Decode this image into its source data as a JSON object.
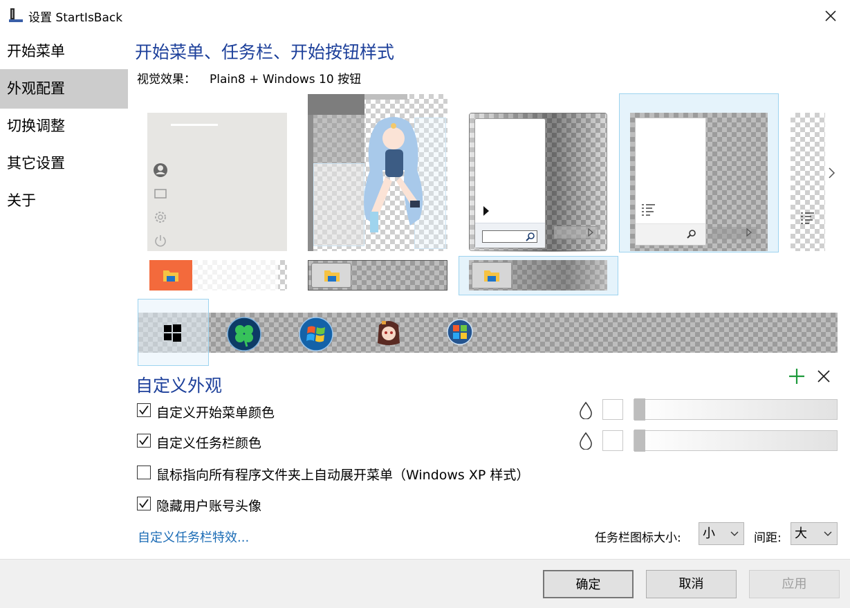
{
  "window": {
    "title": "设置 StartIsBack"
  },
  "sidebar": {
    "items": [
      {
        "label": "开始菜单"
      },
      {
        "label": "外观配置",
        "active": true
      },
      {
        "label": "切换调整"
      },
      {
        "label": "其它设置"
      },
      {
        "label": "关于"
      }
    ]
  },
  "main": {
    "style_title": "开始菜单、任务栏、开始按钮样式",
    "visual_label": "视觉效果：",
    "visual_value": "Plain8 + Windows 10 按钮",
    "custom_title": "自定义外观",
    "options": [
      {
        "label": "自定义开始菜单颜色",
        "checked": true
      },
      {
        "label": "自定义任务栏颜色",
        "checked": true
      },
      {
        "label": "鼠标指向所有程序文件夹上自动展开菜单（Windows XP 样式）",
        "checked": false
      },
      {
        "label": "隐藏用户账号头像",
        "checked": true
      }
    ],
    "taskbar_fx_link": "自定义任务栏特效...",
    "icon_size_label": "任务栏图标大小:",
    "icon_size_value": "小",
    "spacing_label": "间距:",
    "spacing_value": "大"
  },
  "footer": {
    "ok": "确定",
    "cancel": "取消",
    "apply": "应用"
  },
  "colors": {
    "accent_title": "#1c3f9a",
    "link": "#1a6bb5",
    "selection_bg": "#e5f3fb",
    "selection_border": "#9dd3ef",
    "sidebar_active": "#cccccc",
    "plus_green": "#1d9a3b"
  }
}
